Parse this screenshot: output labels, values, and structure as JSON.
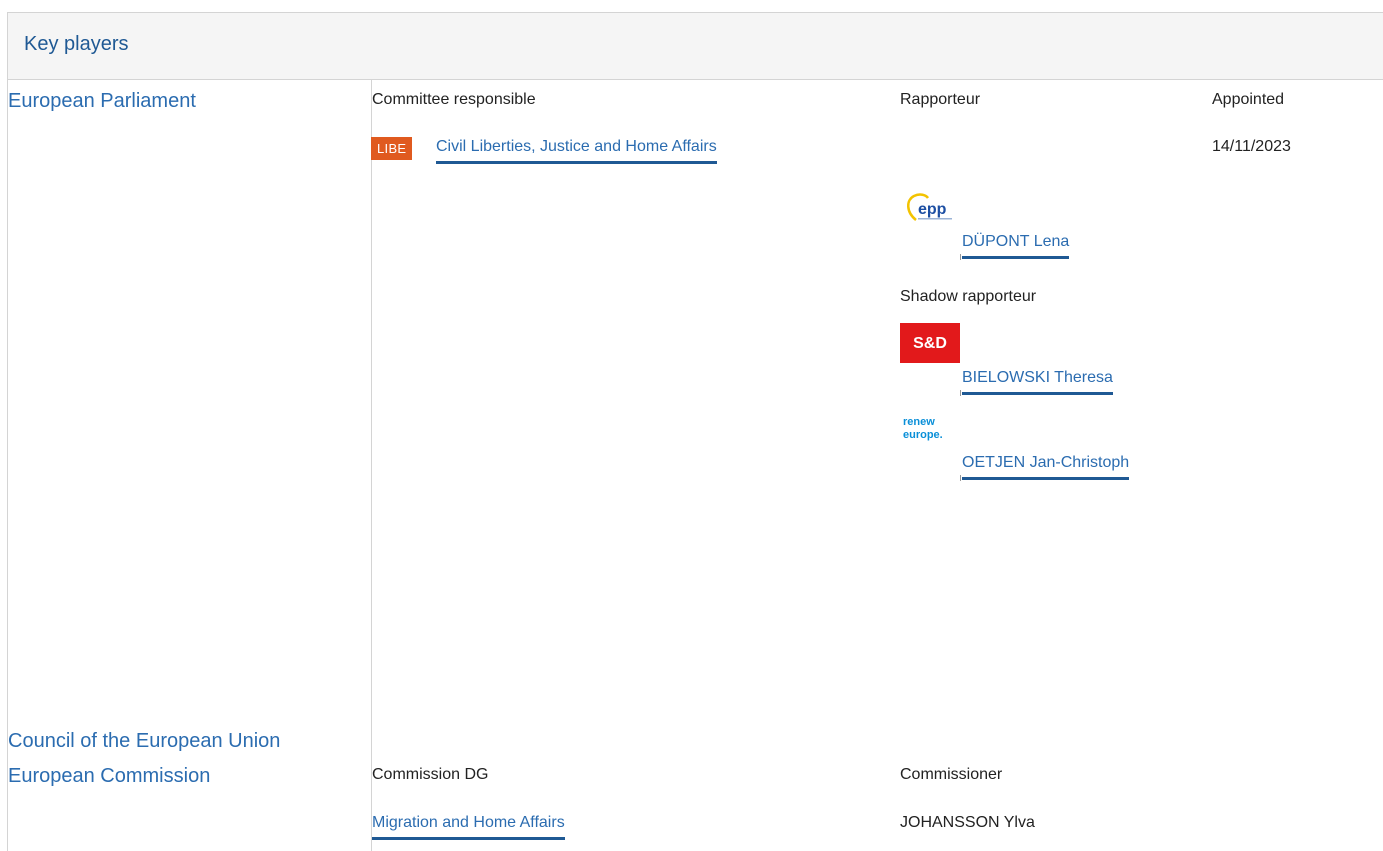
{
  "section": {
    "title": "Key players"
  },
  "institutions": {
    "ep": "European Parliament",
    "council": "Council of the European Union",
    "commission": "European Commission"
  },
  "parliament": {
    "col_committee": "Committee responsible",
    "col_rapporteur": "Rapporteur",
    "col_appointed": "Appointed",
    "committee_badge": "LIBE",
    "committee_name": "Civil Liberties, Justice and Home Affairs",
    "appointed_date": "14/11/2023",
    "rapporteur": {
      "group": "epp",
      "name": "DÜPONT Lena"
    },
    "shadow_label": "Shadow rapporteur",
    "shadows": [
      {
        "group": "S&D",
        "name": "BIELOWSKI Theresa"
      },
      {
        "group": "renew europe.",
        "name": "OETJEN Jan-Christoph"
      }
    ]
  },
  "commission": {
    "col_dg": "Commission DG",
    "col_commissioner": "Commissioner",
    "dg_name": "Migration and Home Affairs",
    "commissioner_name": "JOHANSSON Ylva"
  },
  "colors": {
    "link": "#2b6cb0",
    "underline": "#1f5994",
    "badge": "#e05a1f",
    "sd_red": "#e2191b",
    "renew_blue": "#0a8fd8",
    "epp_blue": "#1d4fa3"
  }
}
